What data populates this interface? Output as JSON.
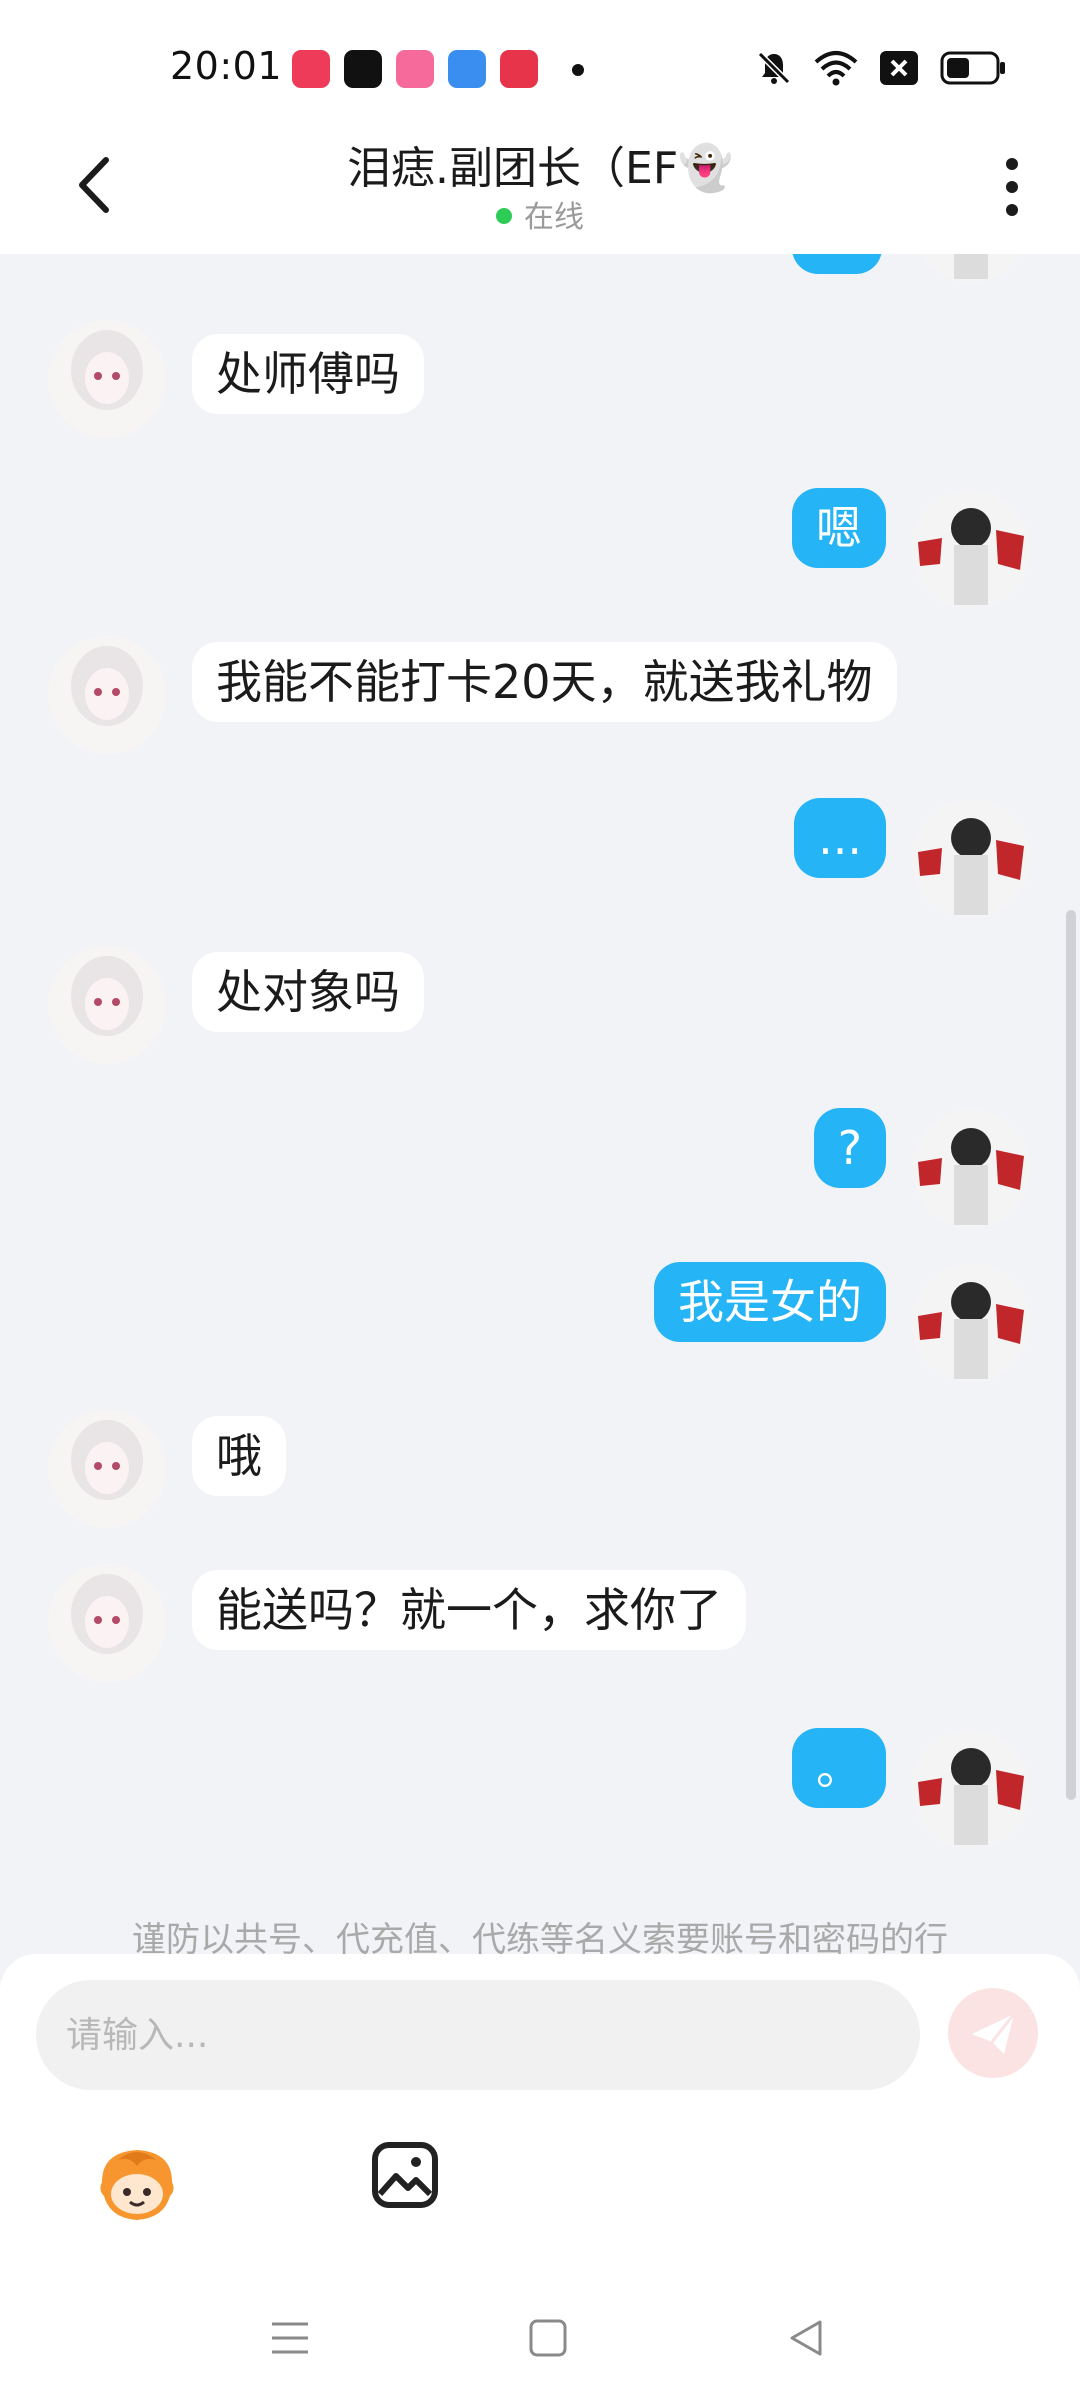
{
  "status_bar": {
    "time": "20:01",
    "app_icons": [
      {
        "name": "kuaishou-icon",
        "color": "#ef3b5a"
      },
      {
        "name": "douyin-icon",
        "color": "#111111"
      },
      {
        "name": "bilibili-icon",
        "color": "#f56a9a"
      },
      {
        "name": "browser-icon",
        "color": "#3a8ef0"
      },
      {
        "name": "music-icon",
        "color": "#e8344a"
      }
    ],
    "right_icons": [
      "mute-icon",
      "wifi-icon",
      "close-box-icon",
      "battery-icon"
    ]
  },
  "header": {
    "title": "泪痣.副团长（EF👻",
    "status": "在线",
    "online_color": "#2ecc56"
  },
  "messages": [
    {
      "side": "in",
      "text": "处师傅吗"
    },
    {
      "side": "out",
      "text": "嗯"
    },
    {
      "side": "in",
      "text": "我能不能打卡20天，就送我礼物"
    },
    {
      "side": "out",
      "text": "..."
    },
    {
      "side": "in",
      "text": "处对象吗"
    },
    {
      "side": "out",
      "text": "?"
    },
    {
      "side": "out",
      "text": "我是女的"
    },
    {
      "side": "in",
      "text": "哦"
    },
    {
      "side": "in",
      "text": "能送吗？就一个，求你了"
    },
    {
      "side": "out",
      "text": "。"
    }
  ],
  "notice": "谨防以共号、代充值、代练等名义索要账号和密码的行",
  "input": {
    "placeholder": "请输入..."
  },
  "colors": {
    "outgoing_bubble": "#25b4f5",
    "incoming_bubble": "#ffffff",
    "background": "#f1f3f7",
    "send_button": "#fce3e3"
  },
  "toolbar_icons": [
    "emoji-icon",
    "image-icon"
  ],
  "nav_icons": [
    "menu-icon",
    "home-icon",
    "back-triangle-icon"
  ]
}
